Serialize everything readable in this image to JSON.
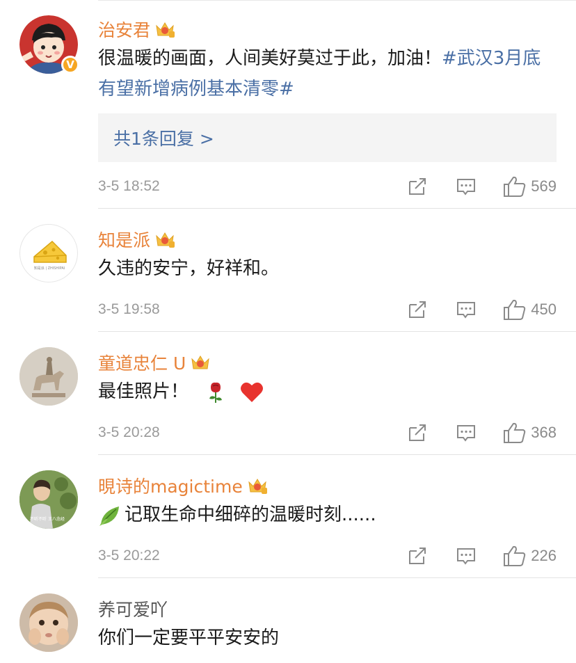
{
  "comments": [
    {
      "username": "治安君",
      "text_plain": "很温暖的画面，人间美好莫过于此，加油！",
      "text_topic": "#武汉3月底有望新增病例基本清零#",
      "reply_link": "共1条回复 >",
      "time": "3-5 18:52",
      "likes": "569",
      "verified_badge": "V"
    },
    {
      "username": "知是派",
      "text": "久违的安宁，好祥和。",
      "avatar_caption": "知是派 | ZHISHIPAI",
      "time": "3-5 19:58",
      "likes": "450"
    },
    {
      "username": "童道忠仁 U",
      "text": "最佳照片！",
      "time": "3-5 20:28",
      "likes": "368"
    },
    {
      "username": "晛诗的magictime",
      "text": "记取生命中细碎的温暖时刻......",
      "avatar_caption": "不听不听 王八念经",
      "time": "3-5 20:22",
      "likes": "226"
    },
    {
      "username": "养可爱吖",
      "text": "你们一定要平平安安的"
    }
  ],
  "colors": {
    "username": "#e8833a",
    "topic": "#4a6fa5",
    "meta": "#9a9a9a",
    "reply_bg": "#f4f4f4"
  },
  "icons": [
    "crown-badge-icon",
    "share-icon",
    "comment-icon",
    "like-icon",
    "rose-emoji",
    "heart-emoji",
    "leaf-emoji"
  ]
}
